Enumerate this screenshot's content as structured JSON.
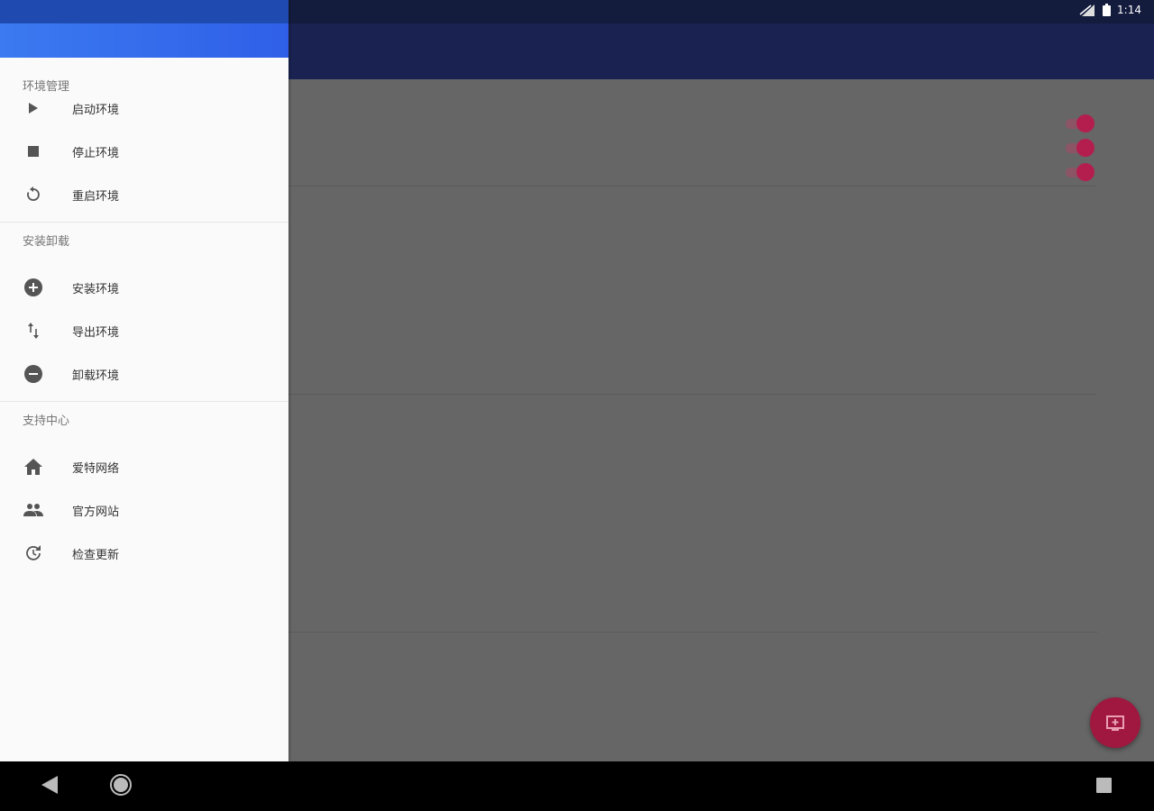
{
  "status_bar": {
    "time": "1:14"
  },
  "drawer": {
    "sections": [
      {
        "title": "环境管理",
        "items": [
          {
            "label": "启动环境",
            "icon": "play-icon"
          },
          {
            "label": "停止环境",
            "icon": "stop-icon"
          },
          {
            "label": "重启环境",
            "icon": "restart-icon"
          }
        ]
      },
      {
        "title": "安装卸载",
        "items": [
          {
            "label": "安装环境",
            "icon": "add-circle-icon"
          },
          {
            "label": "导出环境",
            "icon": "swap-vertical-icon"
          },
          {
            "label": "卸载环境",
            "icon": "remove-circle-icon"
          }
        ]
      },
      {
        "title": "支持中心",
        "items": [
          {
            "label": "爱特网络",
            "icon": "home-icon"
          },
          {
            "label": "官方网站",
            "icon": "people-icon"
          },
          {
            "label": "检查更新",
            "icon": "update-icon"
          }
        ]
      }
    ]
  },
  "colors": {
    "accent": "#b41e4e",
    "appbar": "#1a2252",
    "drawer_header": "#3b7af0"
  }
}
